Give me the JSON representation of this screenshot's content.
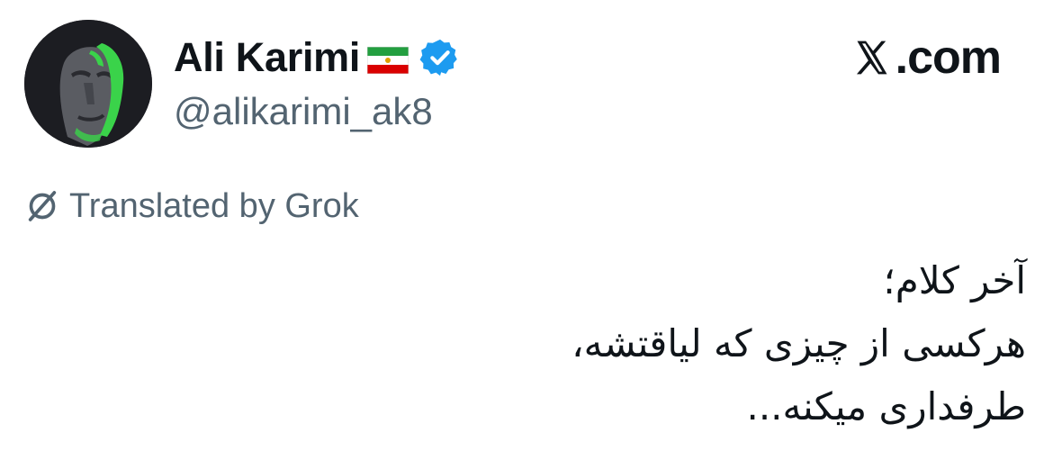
{
  "author": {
    "display_name": "Ali Karimi",
    "handle": "@alikarimi_ak8",
    "avatar_icon": "portrait-avatar-icon",
    "flag_icon": "iran-flag-icon",
    "verified_icon": "verified-badge-icon",
    "verified_color": "#1d9bf0"
  },
  "brand": {
    "text": ".com",
    "logo_icon": "x-logo-icon"
  },
  "translation": {
    "label": "Translated by Grok",
    "icon": "grok-icon"
  },
  "tweet": {
    "lines": [
      "آخر کلام؛",
      "هرکسی از چیزی که لیاقتشه،",
      "طرفداری میکنه..."
    ]
  },
  "colors": {
    "text_primary": "#0f1419",
    "text_secondary": "#536471",
    "accent": "#1d9bf0",
    "avatar_highlight": "#3ad34a"
  }
}
